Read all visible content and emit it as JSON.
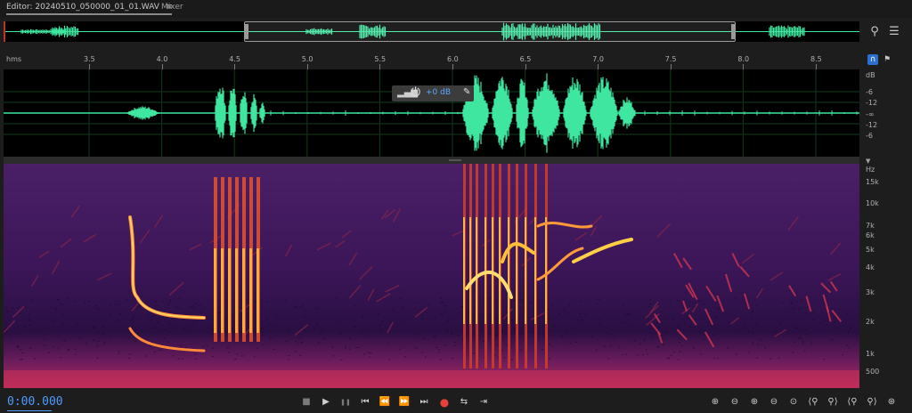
{
  "tabs": {
    "editor": "Editor: 20240510_050000_01_01.WAV",
    "editor_menu_icon": "≡",
    "mixer": "Mixer"
  },
  "ruler": {
    "unit": "hms",
    "ticks": [
      "3.5",
      "4.0",
      "4.5",
      "5.0",
      "5.5",
      "6.0",
      "6.5",
      "7.0",
      "7.5",
      "8.0",
      "8.5"
    ]
  },
  "amplitude_scale": {
    "unit": "dB",
    "labels": [
      "-6",
      "-12",
      "-∞",
      "-12",
      "-6"
    ]
  },
  "hud": {
    "volume": "+0 dB"
  },
  "frequency_scale": {
    "unit": "Hz",
    "labels": [
      "15k",
      "10k",
      "7k",
      "6k",
      "5k",
      "4k",
      "3k",
      "2k",
      "1k",
      "500"
    ]
  },
  "transport": {
    "timecode": "0:00.000"
  },
  "colors": {
    "waveform": "#3ee6a0",
    "timecode": "#4e9bff",
    "record": "#e8403a",
    "playhead": "#c0302c"
  },
  "icons": {
    "stop": "■",
    "play": "▶",
    "pause": "❚❚",
    "to_start": "⏮",
    "rewind": "⏪",
    "fast_forward": "⏩",
    "to_end": "⏭",
    "record": "●",
    "loop": "⇆",
    "skip": "⇥"
  }
}
